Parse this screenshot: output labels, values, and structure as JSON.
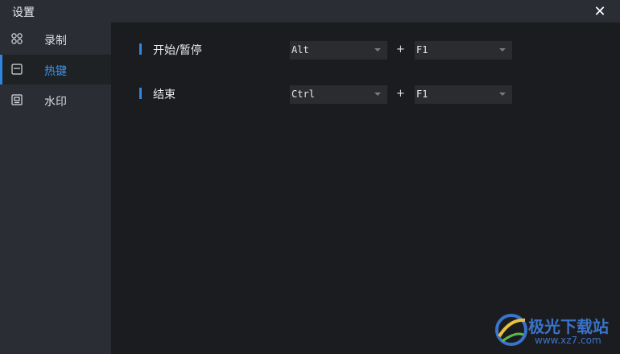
{
  "window": {
    "title": "设置"
  },
  "sidebar": {
    "items": [
      {
        "label": "录制",
        "icon": "grid-icon"
      },
      {
        "label": "热键",
        "icon": "keyboard-icon",
        "active": true
      },
      {
        "label": "水印",
        "icon": "watermark-icon"
      }
    ]
  },
  "hotkeys": [
    {
      "label": "开始/暂停",
      "modifier": "Alt",
      "plus": "+",
      "key": "F1"
    },
    {
      "label": "结束",
      "modifier": "Ctrl",
      "plus": "+",
      "key": "F1"
    }
  ],
  "watermark": {
    "cn": "极光下载站",
    "url": "www.xz7.com"
  },
  "colors": {
    "accent": "#2f86dc",
    "sidebar": "#2a2d34",
    "background": "#1b1c20"
  }
}
